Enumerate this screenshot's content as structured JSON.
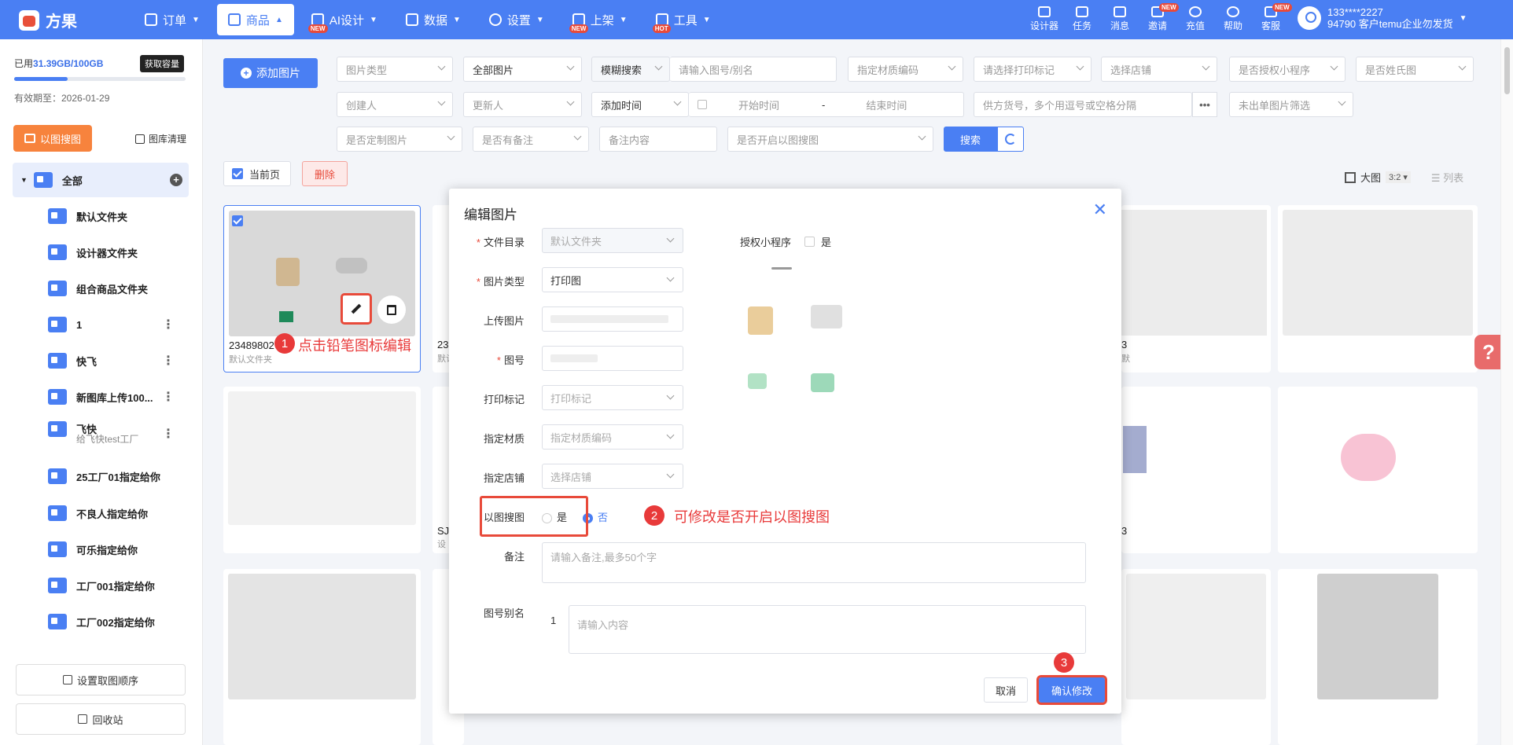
{
  "app": {
    "logo": "方果"
  },
  "nav": [
    {
      "label": "订单"
    },
    {
      "label": "商品"
    },
    {
      "label": "AI设计",
      "badge": "NEW"
    },
    {
      "label": "数据"
    },
    {
      "label": "设置"
    },
    {
      "label": "上架",
      "badge": "NEW"
    },
    {
      "label": "工具",
      "badge": "HOT"
    }
  ],
  "tools": [
    {
      "label": "设计器"
    },
    {
      "label": "任务"
    },
    {
      "label": "消息"
    },
    {
      "label": "邀请",
      "badge": "NEW"
    },
    {
      "label": "充值"
    },
    {
      "label": "帮助"
    },
    {
      "label": "客服",
      "badge": "NEW"
    }
  ],
  "user": {
    "phone": "133****2227",
    "account": "94790 客户temu企业勿发货"
  },
  "sidebar": {
    "storage_prefix": "已用",
    "storage_value": "31.39GB/100GB",
    "storage_fraction": 0.31,
    "get_capacity": "获取容量",
    "expiry": "有效期至：2026-01-29",
    "image_search": "以图搜图",
    "gallery_clean": "图库清理",
    "folders": [
      {
        "label": "全部"
      },
      {
        "label": "默认文件夹"
      },
      {
        "label": "设计器文件夹"
      },
      {
        "label": "组合商品文件夹"
      },
      {
        "label": "1"
      },
      {
        "label": "快飞"
      },
      {
        "label": "新图库上传100..."
      },
      {
        "label": "飞快",
        "sub": "给飞快test工厂"
      },
      {
        "label": "25工厂01指定给你"
      },
      {
        "label": "不良人指定给你"
      },
      {
        "label": "可乐指定给你"
      },
      {
        "label": "工厂001指定给你"
      },
      {
        "label": "工厂002指定给你"
      }
    ],
    "sort_button": "设置取图顺序",
    "recycle_button": "回收站"
  },
  "filters": {
    "add_image": "添加图片",
    "image_type": "图片类型",
    "all_images": "全部图片",
    "fuzzy_search": "模糊搜索",
    "search_placeholder": "请输入图号/别名",
    "material_code": "指定材质编码",
    "print_mark": "请选择打印标记",
    "select_store": "选择店铺",
    "authorized_mini": "是否授权小程序",
    "surname_image": "是否姓氏图",
    "creator": "创建人",
    "updater": "更新人",
    "add_time": "添加时间",
    "start_time": "开始时间",
    "dash": "-",
    "end_time": "结束时间",
    "supplier_sku": "供方货号，多个用逗号或空格分隔",
    "dots": "•••",
    "no_order_filter": "未出单图片筛选",
    "custom_image": "是否定制图片",
    "has_remark": "是否有备注",
    "remark_content": "备注内容",
    "enable_image_search": "是否开启以图搜图",
    "search_btn": "搜索",
    "current_page": "当前页",
    "delete": "删除",
    "view_large": "大图",
    "ratio": "3:2",
    "view_list": "列表"
  },
  "cards": [
    {
      "caption": "23489802",
      "folder": "默认文件夹"
    },
    {
      "caption": "23",
      "folder": "默认"
    },
    {
      "caption": "3",
      "folder": "默"
    },
    {
      "caption": "SJ",
      "folder": "设"
    },
    {
      "caption": "3",
      "folder": ""
    }
  ],
  "annotations": {
    "step1": "1",
    "step1_text": "点击铅笔图标编辑",
    "step2": "2",
    "step2_text": "可修改是否开启以图搜图",
    "step3": "3"
  },
  "modal": {
    "title": "编辑图片",
    "close": "✕",
    "dir_label": "文件目录",
    "dir_value": "默认文件夹",
    "mini_label": "授权小程序",
    "mini_yes": "是",
    "type_label": "图片类型",
    "type_value": "打印图",
    "upload_label": "上传图片",
    "number_label": "图号",
    "print_label": "打印标记",
    "print_value": "打印标记",
    "material_label": "指定材质",
    "material_value": "指定材质编码",
    "store_label": "指定店铺",
    "store_value": "选择店铺",
    "search_label": "以图搜图",
    "search_yes": "是",
    "search_no": "否",
    "remark_label": "备注",
    "remark_placeholder": "请输入备注,最多50个字",
    "alias_label": "图号别名",
    "alias_index": "1",
    "alias_placeholder": "请输入内容",
    "cancel": "取消",
    "confirm": "确认修改"
  },
  "colors": {
    "primary": "#4a7ff3",
    "danger": "#e84a3a",
    "orange": "#f7833d"
  }
}
